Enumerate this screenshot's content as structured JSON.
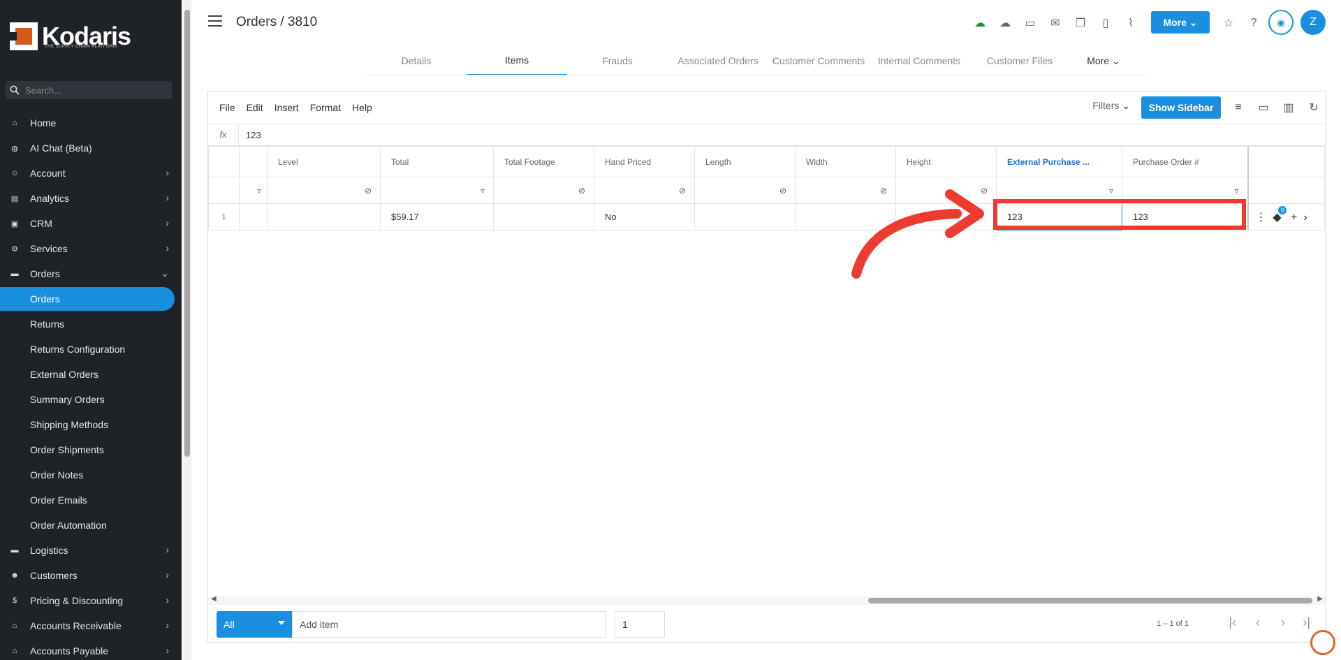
{
  "brand": {
    "name": "Kodaris",
    "tagline": "THE SUPPLY CHAIN PLATFORM"
  },
  "search": {
    "placeholder": "Search..."
  },
  "sidebar": {
    "items": [
      {
        "label": "Home",
        "icon": "home-icon"
      },
      {
        "label": "AI Chat (Beta)",
        "icon": "robot-icon"
      },
      {
        "label": "Account",
        "icon": "person-icon"
      },
      {
        "label": "Analytics",
        "icon": "chart-icon"
      },
      {
        "label": "CRM",
        "icon": "contact-card-icon"
      },
      {
        "label": "Services",
        "icon": "gears-icon"
      },
      {
        "label": "Orders",
        "icon": "truck-icon"
      }
    ],
    "sub_items": [
      "Orders",
      "Returns",
      "Returns Configuration",
      "External Orders",
      "Summary Orders",
      "Shipping Methods",
      "Order Shipments",
      "Order Notes",
      "Order Emails",
      "Order Automation"
    ],
    "bottom_items": [
      {
        "label": "Logistics",
        "icon": "truck-icon"
      },
      {
        "label": "Customers",
        "icon": "people-icon"
      },
      {
        "label": "Pricing & Discounting",
        "icon": "dollar-icon"
      },
      {
        "label": "Accounts Receivable",
        "icon": "bank-icon"
      },
      {
        "label": "Accounts Payable",
        "icon": "bank-icon"
      }
    ]
  },
  "header": {
    "title": "Orders / 3810",
    "more_label": "More",
    "avatar_letter": "Z"
  },
  "tabs": [
    "Details",
    "Items",
    "Frauds",
    "Associated Orders",
    "Customer Comments",
    "Internal Comments",
    "Customer Files",
    "More"
  ],
  "menubar": {
    "items": [
      "File",
      "Edit",
      "Insert",
      "Format",
      "Help"
    ],
    "filters_label": "Filters",
    "show_sidebar_label": "Show Sidebar"
  },
  "formula": {
    "label": "fx",
    "value": "123"
  },
  "grid": {
    "columns": [
      "",
      "Level",
      "Total",
      "Total Footage",
      "Hand Priced",
      "Length",
      "Width",
      "Height",
      "External Purchase ...",
      "Purchase Order #"
    ],
    "rows": [
      {
        "num": "1",
        "cells": [
          "",
          "",
          "$59.17",
          "",
          "No",
          "",
          "",
          "",
          "123",
          "123"
        ]
      }
    ],
    "badge": "0"
  },
  "footer": {
    "select_value": "All",
    "add_item_placeholder": "Add item",
    "qty_value": "1",
    "paging": "1 – 1 of 1"
  },
  "colors": {
    "accent": "#1a8fe0",
    "highlight": "#ee3b30",
    "sidebar": "#1f2328"
  }
}
